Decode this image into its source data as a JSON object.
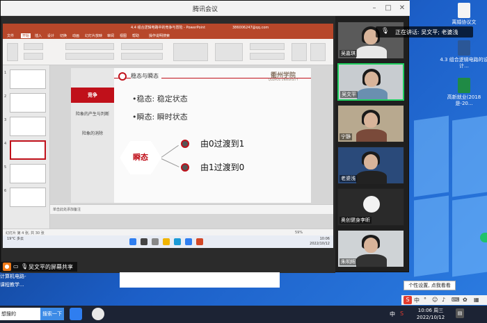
{
  "meeting": {
    "title": "腾讯会议",
    "speaking_label": "正在讲话: 吴文平; 老婆浅",
    "presenter_label": "吴文平的屏幕共享"
  },
  "ppt": {
    "window_title": "4.4 组合逻辑电路中的竞争与冒险 - PowerPoint",
    "user": "386006247@qq.com",
    "menu": [
      "文件",
      "开始",
      "插入",
      "设计",
      "切换",
      "动画",
      "幻灯片放映",
      "审阅",
      "视图",
      "帮助",
      "操作说明搜索"
    ],
    "thumbs": [
      "1",
      "2",
      "3",
      "4",
      "5",
      "6"
    ],
    "notes_placeholder": "单击此处添加备注",
    "status_left": "幻灯片 第 4 张, 共 30 张",
    "status_right": "59%"
  },
  "slide": {
    "header": "稳态与瞬态",
    "logo": "衢州学院",
    "logo_sub": "QUZHOU UNIVERSITY",
    "side_items": [
      "竞争",
      "险象的产生与判断",
      "险象的消除"
    ],
    "bullets": [
      "•稳态: 稳定状态",
      "•瞬态: 瞬时状态"
    ],
    "hex_label": "瞬态",
    "items": [
      "由0过渡到1",
      "由1过渡到0"
    ]
  },
  "inner_taskbar": {
    "weather": "19°C 多云",
    "time": "10:06",
    "date": "2022/10/12"
  },
  "participants": [
    {
      "name": "吴嘉琪"
    },
    {
      "name": "吴文平"
    },
    {
      "name": "宁静"
    },
    {
      "name": "老婆浅"
    },
    {
      "name": "奥创健身李昕"
    },
    {
      "name": "朱明辉"
    }
  ],
  "desktop": {
    "icons": [
      {
        "label": "离婚协议文"
      },
      {
        "label": "4.3 组合逻辑电路的设计..."
      },
      {
        "label": "高新就业(2018是-20..."
      }
    ],
    "text1": "计算机电路-",
    "text2": "课程教学..."
  },
  "tooltip": "个性设置, 点我看看",
  "taskbar": {
    "search_value": "想搜的",
    "search_button": "搜索一下",
    "time": "10:06 周三",
    "date": "2022/10/12",
    "ime": "中"
  },
  "colors": {
    "accent_red": "#c0101a",
    "ppt_red": "#b7472a",
    "active_green": "#1fd05f"
  }
}
